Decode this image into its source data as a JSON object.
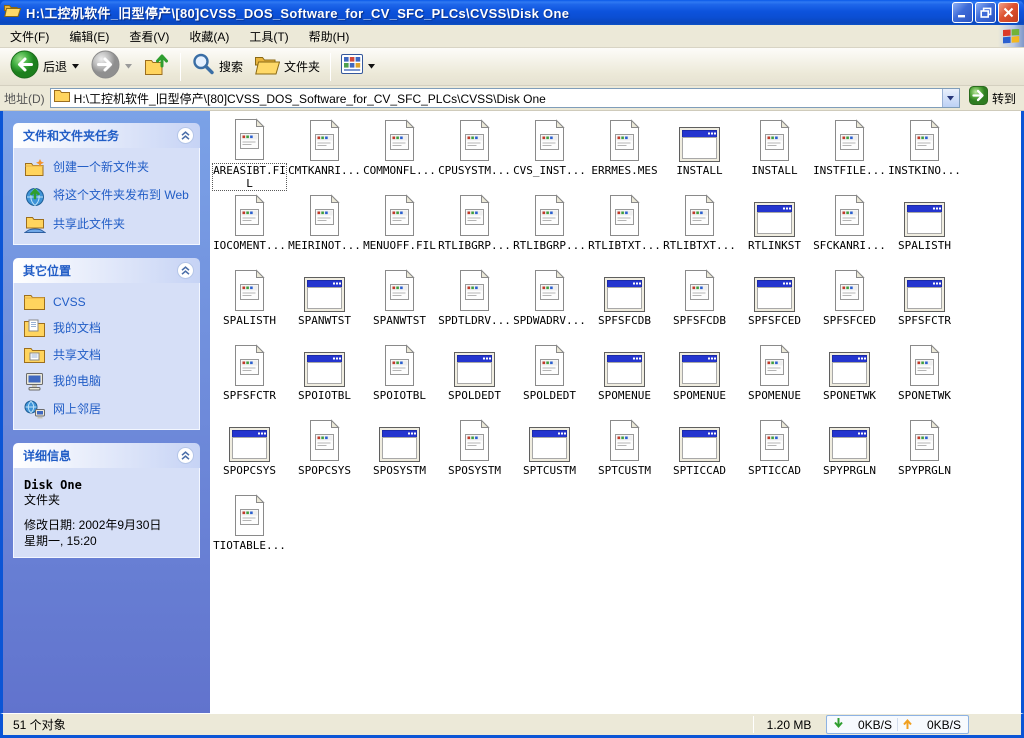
{
  "window": {
    "title": "H:\\工控机软件_旧型停产\\[80]CVSS_DOS_Software_for_CV_SFC_PLCs\\CVSS\\Disk One"
  },
  "menu": {
    "items": [
      {
        "label": "文件(F)"
      },
      {
        "label": "编辑(E)"
      },
      {
        "label": "查看(V)"
      },
      {
        "label": "收藏(A)"
      },
      {
        "label": "工具(T)"
      },
      {
        "label": "帮助(H)"
      }
    ]
  },
  "toolbar": {
    "back_label": "后退",
    "search_label": "搜索",
    "folders_label": "文件夹"
  },
  "address": {
    "label": "地址(D)",
    "value": "H:\\工控机软件_旧型停产\\[80]CVSS_DOS_Software_for_CV_SFC_PLCs\\CVSS\\Disk One",
    "go_label": "转到"
  },
  "sidebar": {
    "panels": [
      {
        "title": "文件和文件夹任务",
        "items": [
          {
            "label": "创建一个新文件夹",
            "icon": "new-folder-icon"
          },
          {
            "label": "将这个文件夹发布到 Web",
            "icon": "publish-web-icon"
          },
          {
            "label": "共享此文件夹",
            "icon": "share-folder-icon"
          }
        ]
      },
      {
        "title": "其它位置",
        "items": [
          {
            "label": "CVSS",
            "icon": "folder-icon"
          },
          {
            "label": "我的文档",
            "icon": "my-documents-icon"
          },
          {
            "label": "共享文档",
            "icon": "shared-documents-icon"
          },
          {
            "label": "我的电脑",
            "icon": "my-computer-icon"
          },
          {
            "label": "网上邻居",
            "icon": "network-places-icon"
          }
        ]
      },
      {
        "title": "详细信息",
        "details": {
          "name": "Disk One",
          "type": "文件夹",
          "modified_date": "修改日期: 2002年9月30日",
          "modified_day_time": "星期一, 15:20"
        }
      }
    ]
  },
  "files": [
    {
      "name": "AREASIBT.FIL",
      "icon": "file",
      "selected": true
    },
    {
      "name": "CMTKANRI...",
      "icon": "file"
    },
    {
      "name": "COMMONFL...",
      "icon": "file"
    },
    {
      "name": "CPUSYSTM...",
      "icon": "file"
    },
    {
      "name": "CVS_INST...",
      "icon": "file"
    },
    {
      "name": "ERRMES.MES",
      "icon": "file"
    },
    {
      "name": "INSTALL",
      "icon": "app"
    },
    {
      "name": "INSTALL",
      "icon": "file"
    },
    {
      "name": "INSTFILE...",
      "icon": "file"
    },
    {
      "name": "INSTKINO...",
      "icon": "file"
    },
    {
      "name": "IOCOMENT...",
      "icon": "file"
    },
    {
      "name": "MEIRINOT...",
      "icon": "file"
    },
    {
      "name": "MENUOFF.FIL",
      "icon": "file"
    },
    {
      "name": "RTLIBGRP...",
      "icon": "file"
    },
    {
      "name": "RTLIBGRP...",
      "icon": "file"
    },
    {
      "name": "RTLIBTXT...",
      "icon": "file"
    },
    {
      "name": "RTLIBTXT...",
      "icon": "file"
    },
    {
      "name": "RTLINKST",
      "icon": "app"
    },
    {
      "name": "SFCKANRI...",
      "icon": "file"
    },
    {
      "name": "SPALISTH",
      "icon": "app"
    },
    {
      "name": "SPALISTH",
      "icon": "file"
    },
    {
      "name": "SPANWTST",
      "icon": "app"
    },
    {
      "name": "SPANWTST",
      "icon": "file"
    },
    {
      "name": "SPDTLDRV...",
      "icon": "file"
    },
    {
      "name": "SPDWADRV...",
      "icon": "file"
    },
    {
      "name": "SPFSFCDB",
      "icon": "app"
    },
    {
      "name": "SPFSFCDB",
      "icon": "file"
    },
    {
      "name": "SPFSFCED",
      "icon": "app"
    },
    {
      "name": "SPFSFCED",
      "icon": "file"
    },
    {
      "name": "SPFSFCTR",
      "icon": "app"
    },
    {
      "name": "SPFSFCTR",
      "icon": "file"
    },
    {
      "name": "SPOIOTBL",
      "icon": "app"
    },
    {
      "name": "SPOIOTBL",
      "icon": "file"
    },
    {
      "name": "SPOLDEDT",
      "icon": "app"
    },
    {
      "name": "SPOLDEDT",
      "icon": "file"
    },
    {
      "name": "SPOMENUE",
      "icon": "app"
    },
    {
      "name": "SPOMENUE",
      "icon": "app"
    },
    {
      "name": "SPOMENUE",
      "icon": "file"
    },
    {
      "name": "SPONETWK",
      "icon": "app"
    },
    {
      "name": "SPONETWK",
      "icon": "file"
    },
    {
      "name": "SPOPCSYS",
      "icon": "app"
    },
    {
      "name": "SPOPCSYS",
      "icon": "file"
    },
    {
      "name": "SPOSYSTM",
      "icon": "app"
    },
    {
      "name": "SPOSYSTM",
      "icon": "file"
    },
    {
      "name": "SPTCUSTM",
      "icon": "app"
    },
    {
      "name": "SPTCUSTM",
      "icon": "file"
    },
    {
      "name": "SPTICCAD",
      "icon": "app"
    },
    {
      "name": "SPTICCAD",
      "icon": "file"
    },
    {
      "name": "SPYPRGLN",
      "icon": "app"
    },
    {
      "name": "SPYPRGLN",
      "icon": "file"
    },
    {
      "name": "TIOTABLE...",
      "icon": "file"
    }
  ],
  "status": {
    "objects": "51 个对象",
    "size": "1.20 MB",
    "download": "0KB/S",
    "upload": "0KB/S"
  },
  "colors": {
    "titlebar_blue": "#0d53dd",
    "taskpane_blue": "#7ba2e7",
    "panel_body": "#d6dff7",
    "link_blue": "#215dc6",
    "toolbar_beige": "#ece9d8",
    "icon_titlebar_blue": "#2435cf",
    "download_green": "#2f9e2f",
    "upload_orange": "#f0a020"
  }
}
